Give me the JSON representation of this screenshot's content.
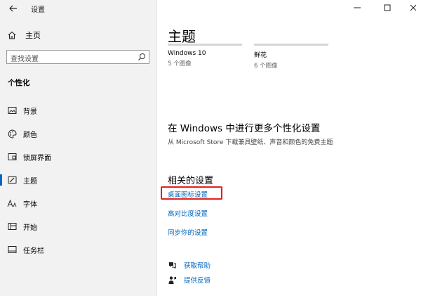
{
  "app": {
    "title": "设置"
  },
  "sidebar": {
    "home_label": "主页",
    "search_placeholder": "查找设置",
    "section_title": "个性化",
    "items": [
      {
        "label": "背景",
        "icon": "picture-icon"
      },
      {
        "label": "颜色",
        "icon": "palette-icon"
      },
      {
        "label": "锁屏界面",
        "icon": "lock-screen-icon"
      },
      {
        "label": "主题",
        "icon": "theme-brush-icon",
        "selected": true
      },
      {
        "label": "字体",
        "icon": "font-icon"
      },
      {
        "label": "开始",
        "icon": "start-menu-icon"
      },
      {
        "label": "任务栏",
        "icon": "taskbar-icon"
      }
    ]
  },
  "main": {
    "title": "主题",
    "themes": [
      {
        "name": "Windows 10",
        "count": "5 个图像"
      },
      {
        "name": "鲜花",
        "count": "6 个图像"
      }
    ],
    "more": {
      "heading": "在 Windows 中进行更多个性化设置",
      "subtext": "从 Microsoft Store 下载兼具壁纸、声音和颜色的免费主题"
    },
    "related": {
      "heading": "相关的设置",
      "links": [
        "桌面图标设置",
        "高对比度设置",
        "同步你的设置"
      ]
    },
    "help": {
      "get_help": "获取帮助",
      "feedback": "提供反馈"
    }
  },
  "colors": {
    "accent": "#0067c0",
    "highlight": "#e3211f",
    "sidebar_bg": "#f2f2f2"
  }
}
